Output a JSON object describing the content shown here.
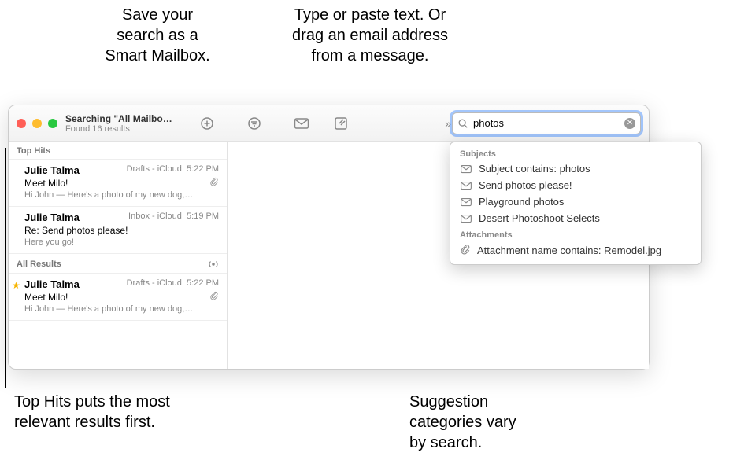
{
  "annotations": {
    "smart_mailbox": "Save your\nsearch as a\nSmart Mailbox.",
    "search_hint": "Type or paste text. Or\ndrag an email address\nfrom a message.",
    "top_hits": "Top Hits puts the most\nrelevant results first.",
    "sugg_cats": "Suggestion\ncategories vary\nby search."
  },
  "window": {
    "title": "Searching \"All Mailbo…",
    "subtitle": "Found 16 results",
    "search_value": "photos"
  },
  "list": {
    "top_hits_label": "Top Hits",
    "all_results_label": "All Results",
    "messages": [
      {
        "sender": "Julie Talma",
        "box": "Drafts - iCloud",
        "time": "5:22 PM",
        "subject": "Meet Milo!",
        "preview": "Hi John — Here's a photo of my new dog,…",
        "has_attachment": true,
        "starred": false
      },
      {
        "sender": "Julie Talma",
        "box": "Inbox - iCloud",
        "time": "5:19 PM",
        "subject": "Re: Send photos please!",
        "preview": "Here you go!",
        "has_attachment": false,
        "starred": false
      },
      {
        "sender": "Julie Talma",
        "box": "Drafts - iCloud",
        "time": "5:22 PM",
        "subject": "Meet Milo!",
        "preview": "Hi John — Here's a photo of my new dog,…",
        "has_attachment": true,
        "starred": true
      }
    ]
  },
  "suggestions": {
    "subjects_label": "Subjects",
    "attachments_label": "Attachments",
    "items": [
      {
        "icon": "mail",
        "text": "Subject contains: photos"
      },
      {
        "icon": "mail",
        "text": "Send photos please!"
      },
      {
        "icon": "mail",
        "text": "Playground photos"
      },
      {
        "icon": "mail",
        "text": "Desert Photoshoot Selects"
      }
    ],
    "attachment_item": {
      "icon": "clip",
      "text": "Attachment name contains: Remodel.jpg"
    }
  }
}
